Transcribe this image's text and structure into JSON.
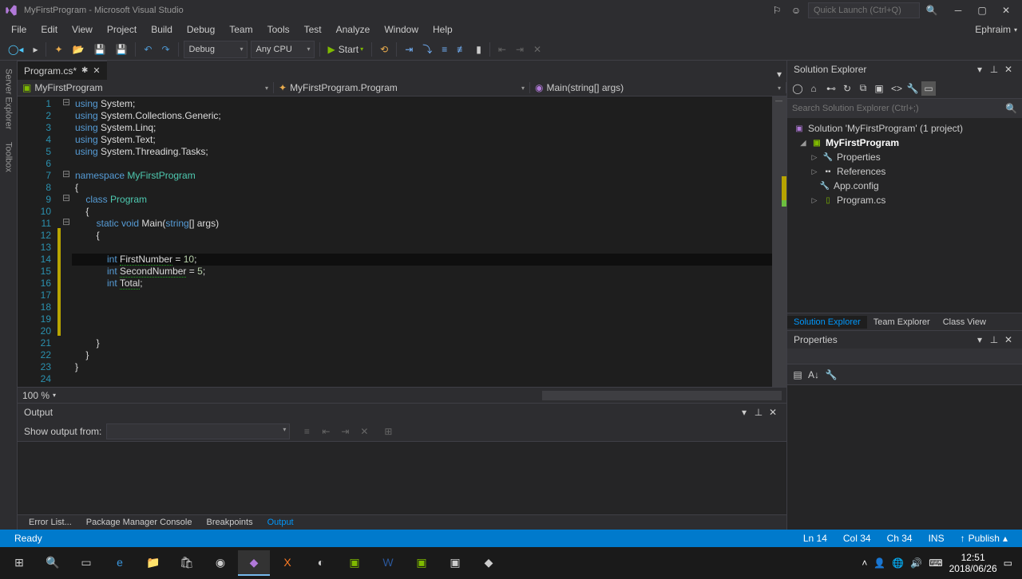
{
  "titlebar": {
    "title": "MyFirstProgram - Microsoft Visual Studio",
    "quick_launch_placeholder": "Quick Launch (Ctrl+Q)"
  },
  "menu": {
    "file": "File",
    "edit": "Edit",
    "view": "View",
    "project": "Project",
    "build": "Build",
    "debug": "Debug",
    "team": "Team",
    "tools": "Tools",
    "test": "Test",
    "analyze": "Analyze",
    "window": "Window",
    "help": "Help",
    "user": "Ephraim"
  },
  "toolbar": {
    "config": "Debug",
    "platform": "Any CPU",
    "start": "Start"
  },
  "left_tabs": {
    "server": "Server Explorer",
    "toolbox": "Toolbox"
  },
  "doc_tab": {
    "name": "Program.cs*"
  },
  "nav": {
    "scope": "MyFirstProgram",
    "class": "MyFirstProgram.Program",
    "member": "Main(string[] args)"
  },
  "zoom": "100 %",
  "code": {
    "lines": [
      {
        "n": 1,
        "html": "<span class='kw'>using</span> System;"
      },
      {
        "n": 2,
        "html": "<span class='kw'>using</span> System.Collections.Generic;"
      },
      {
        "n": 3,
        "html": "<span class='kw'>using</span> System.Linq;"
      },
      {
        "n": 4,
        "html": "<span class='kw'>using</span> System.Text;"
      },
      {
        "n": 5,
        "html": "<span class='kw'>using</span> System.Threading.Tasks;"
      },
      {
        "n": 6,
        "html": ""
      },
      {
        "n": 7,
        "html": "<span class='kw'>namespace</span> <span class='cls'>MyFirstProgram</span>"
      },
      {
        "n": 8,
        "html": "{"
      },
      {
        "n": 9,
        "html": "    <span class='kw'>class</span> <span class='cls'>Program</span>"
      },
      {
        "n": 10,
        "html": "    {"
      },
      {
        "n": 11,
        "html": "        <span class='kw'>static</span> <span class='kw'>void</span> Main(<span class='kw'>string</span>[] args)"
      },
      {
        "n": 12,
        "html": "        {"
      },
      {
        "n": 13,
        "html": ""
      },
      {
        "n": 14,
        "html": "            <span class='kw'>int</span> <span class='warn'>FirstNumber</span> = <span class='num'>10</span>;",
        "hl": true
      },
      {
        "n": 15,
        "html": "            <span class='kw'>int</span> <span class='warn'>SecondNumber</span> = <span class='num'>5</span>;"
      },
      {
        "n": 16,
        "html": "            <span class='kw'>int</span> <span class='warn'>Total</span>;"
      },
      {
        "n": 17,
        "html": ""
      },
      {
        "n": 18,
        "html": ""
      },
      {
        "n": 19,
        "html": ""
      },
      {
        "n": 20,
        "html": ""
      },
      {
        "n": 21,
        "html": "        }"
      },
      {
        "n": 22,
        "html": "    }"
      },
      {
        "n": 23,
        "html": "}"
      },
      {
        "n": 24,
        "html": ""
      }
    ]
  },
  "output": {
    "title": "Output",
    "show_from": "Show output from:"
  },
  "bottom_tabs": {
    "error": "Error List...",
    "pmc": "Package Manager Console",
    "bp": "Breakpoints",
    "out": "Output"
  },
  "solution": {
    "title": "Solution Explorer",
    "search_placeholder": "Search Solution Explorer (Ctrl+;)",
    "root": "Solution 'MyFirstProgram' (1 project)",
    "project": "MyFirstProgram",
    "items": [
      "Properties",
      "References",
      "App.config",
      "Program.cs"
    ],
    "tabs": {
      "se": "Solution Explorer",
      "te": "Team Explorer",
      "cv": "Class View"
    }
  },
  "properties": {
    "title": "Properties"
  },
  "status": {
    "ready": "Ready",
    "ln": "Ln 14",
    "col": "Col 34",
    "ch": "Ch 34",
    "ins": "INS",
    "publish": "Publish"
  },
  "taskbar": {
    "time": "12:51",
    "date": "2018/06/26"
  }
}
